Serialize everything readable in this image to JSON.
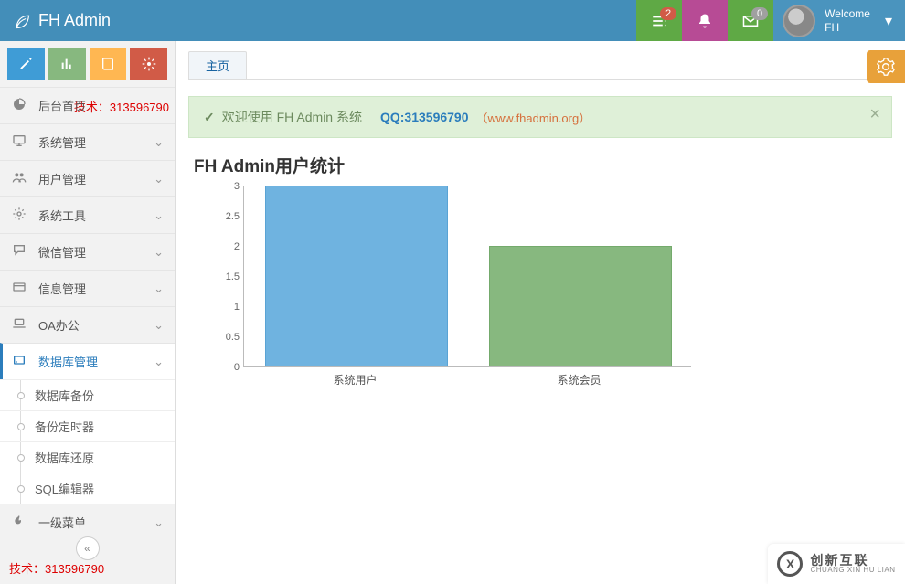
{
  "header": {
    "brand": "FH Admin",
    "tasks_badge": "2",
    "mail_badge": "0",
    "welcome_line1": "Welcome",
    "welcome_line2": "FH"
  },
  "sidebar": {
    "tech_label_1": "技术：313596790",
    "tech_label_2": "技术：313596790",
    "items": [
      {
        "icon": "dashboard",
        "label": "后台首页",
        "expandable": false
      },
      {
        "icon": "desktop",
        "label": "系统管理",
        "expandable": true
      },
      {
        "icon": "users",
        "label": "用户管理",
        "expandable": true
      },
      {
        "icon": "cog",
        "label": "系统工具",
        "expandable": true
      },
      {
        "icon": "comments",
        "label": "微信管理",
        "expandable": true
      },
      {
        "icon": "card",
        "label": "信息管理",
        "expandable": true
      },
      {
        "icon": "laptop",
        "label": "OA办公",
        "expandable": true
      },
      {
        "icon": "hdd",
        "label": "数据库管理",
        "expandable": true,
        "active": true
      },
      {
        "icon": "fire",
        "label": "一级菜单",
        "expandable": true
      }
    ],
    "db_subitems": [
      "数据库备份",
      "备份定时器",
      "数据库还原",
      "SQL编辑器"
    ]
  },
  "main": {
    "tab_label": "主页",
    "alert_checkmark": "✓",
    "alert_text": "欢迎使用 FH Admin 系统",
    "alert_qq": "QQ:313596790",
    "alert_link": "（www.fhadmin.org）",
    "chart_title": "FH Admin用户统计"
  },
  "chart_data": {
    "type": "bar",
    "categories": [
      "系统用户",
      "系统会员"
    ],
    "values": [
      3,
      2
    ],
    "series_colors": [
      "#6fb3e0",
      "#87b87f"
    ],
    "ylim": [
      0,
      3
    ],
    "y_ticks": [
      0,
      0.5,
      1,
      1.5,
      2,
      2.5,
      3
    ],
    "title": "FH Admin用户统计",
    "xlabel": "",
    "ylabel": ""
  },
  "watermark": {
    "cn": "创新互联",
    "py": "CHUANG XIN HU LIAN"
  }
}
